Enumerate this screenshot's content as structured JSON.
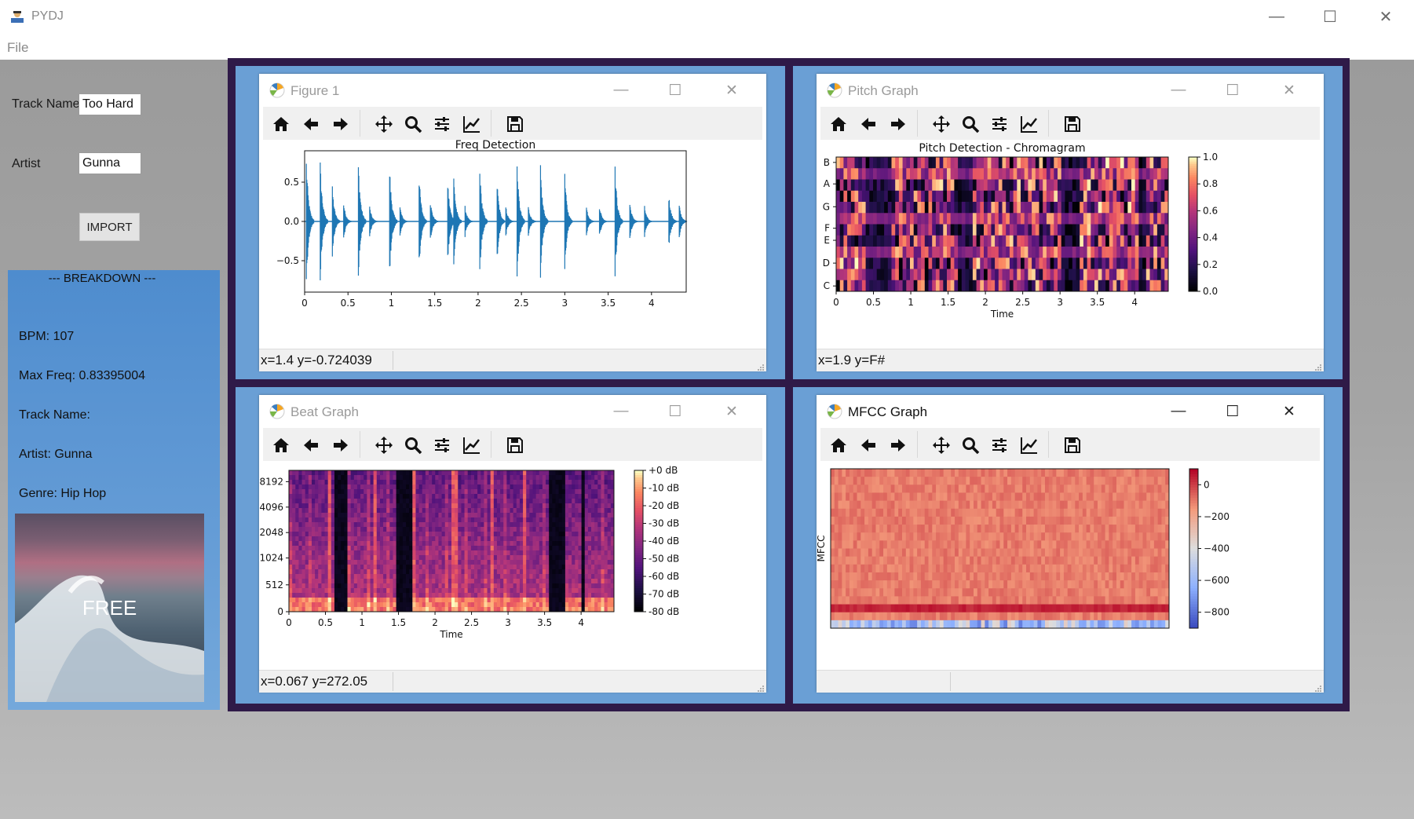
{
  "app": {
    "title": "PYDJ",
    "menu": [
      "File"
    ]
  },
  "form": {
    "track_name_label": "Track Name",
    "track_name_value": "Too Hard",
    "artist_label": "Artist",
    "artist_value": "Gunna",
    "import_button": "IMPORT"
  },
  "breakdown": {
    "title": "---  BREAKDOWN  ---",
    "bpm": "BPM: 107",
    "max_freq": "Max Freq: 0.83395004",
    "track_name": "Track Name:",
    "artist": "Artist: Gunna",
    "genre": "Genre: Hip Hop",
    "album_art_text": "FREE"
  },
  "windows": [
    {
      "title": "Figure 1",
      "status": "x=1.4 y=-0.724039"
    },
    {
      "title": "Pitch Graph",
      "status": "x=1.9 y=F#"
    },
    {
      "title": "Beat Graph",
      "status": "x=0.067 y=272.05"
    },
    {
      "title": "MFCC Graph",
      "status": ""
    }
  ],
  "colors": {
    "accent": "#1f77b4",
    "desktop": "#a6a6a6",
    "pane": "#6a9fd5",
    "grid_bg": "#2f1a48",
    "panel": "#5f98d4"
  },
  "chart_data": [
    {
      "type": "line",
      "title": "Freq Detection",
      "xlabel": "",
      "ylabel": "",
      "xlim": [
        0,
        4.4
      ],
      "ylim": [
        -0.9,
        0.9
      ],
      "x_ticks": [
        "0",
        "0.5",
        "1",
        "1.5",
        "2",
        "2.5",
        "3",
        "3.5",
        "4"
      ],
      "y_ticks": [
        "0.5",
        "0.0",
        "−0.5"
      ],
      "series": [
        {
          "color": "#1f77b4",
          "onsets": [
            0.02,
            0.18,
            0.32,
            0.45,
            0.62,
            0.75,
            0.98,
            1.1,
            1.32,
            1.45,
            1.65,
            1.72,
            1.85,
            2.02,
            2.22,
            2.32,
            2.45,
            2.58,
            2.72,
            3.0,
            3.25,
            3.4,
            3.58,
            3.75,
            3.92,
            4.2,
            4.32
          ],
          "amplitudes": [
            0.82,
            0.78,
            0.45,
            0.25,
            0.78,
            0.2,
            0.72,
            0.2,
            0.62,
            0.28,
            0.55,
            0.6,
            0.2,
            0.7,
            0.52,
            0.2,
            0.75,
            0.2,
            0.72,
            0.62,
            0.2,
            0.22,
            0.72,
            0.25,
            0.2,
            0.35,
            0.22
          ]
        }
      ]
    },
    {
      "type": "heatmap",
      "title": "Pitch Detection - Chromagram",
      "xlabel": "Time",
      "x_ticks": [
        "0",
        "0.5",
        "1",
        "1.5",
        "2",
        "2.5",
        "3",
        "3.5",
        "4"
      ],
      "y_ticks": [
        "B",
        "A",
        "G",
        "F",
        "E",
        "D",
        "C"
      ],
      "colorbar": {
        "ticks": [
          "1.0",
          "0.8",
          "0.6",
          "0.4",
          "0.2",
          "0.0"
        ],
        "range": [
          0.0,
          1.0
        ],
        "colormap": "magma"
      }
    },
    {
      "type": "heatmap",
      "title": "",
      "xlabel": "Time",
      "x_ticks": [
        "0",
        "0.5",
        "1",
        "1.5",
        "2",
        "2.5",
        "3",
        "3.5",
        "4"
      ],
      "y_ticks": [
        "8192",
        "4096",
        "2048",
        "1024",
        "512",
        "0"
      ],
      "colorbar": {
        "ticks": [
          "+0 dB",
          "-10 dB",
          "-20 dB",
          "-30 dB",
          "-40 dB",
          "-50 dB",
          "-60 dB",
          "-70 dB",
          "-80 dB"
        ],
        "range": [
          -80,
          0
        ],
        "colormap": "magma"
      }
    },
    {
      "type": "heatmap",
      "title": "",
      "ylabel": "MFCC",
      "colorbar": {
        "ticks": [
          "0",
          "−200",
          "−400",
          "−600",
          "−800"
        ],
        "range": [
          -900,
          100
        ],
        "colormap": "coolwarm"
      }
    }
  ]
}
